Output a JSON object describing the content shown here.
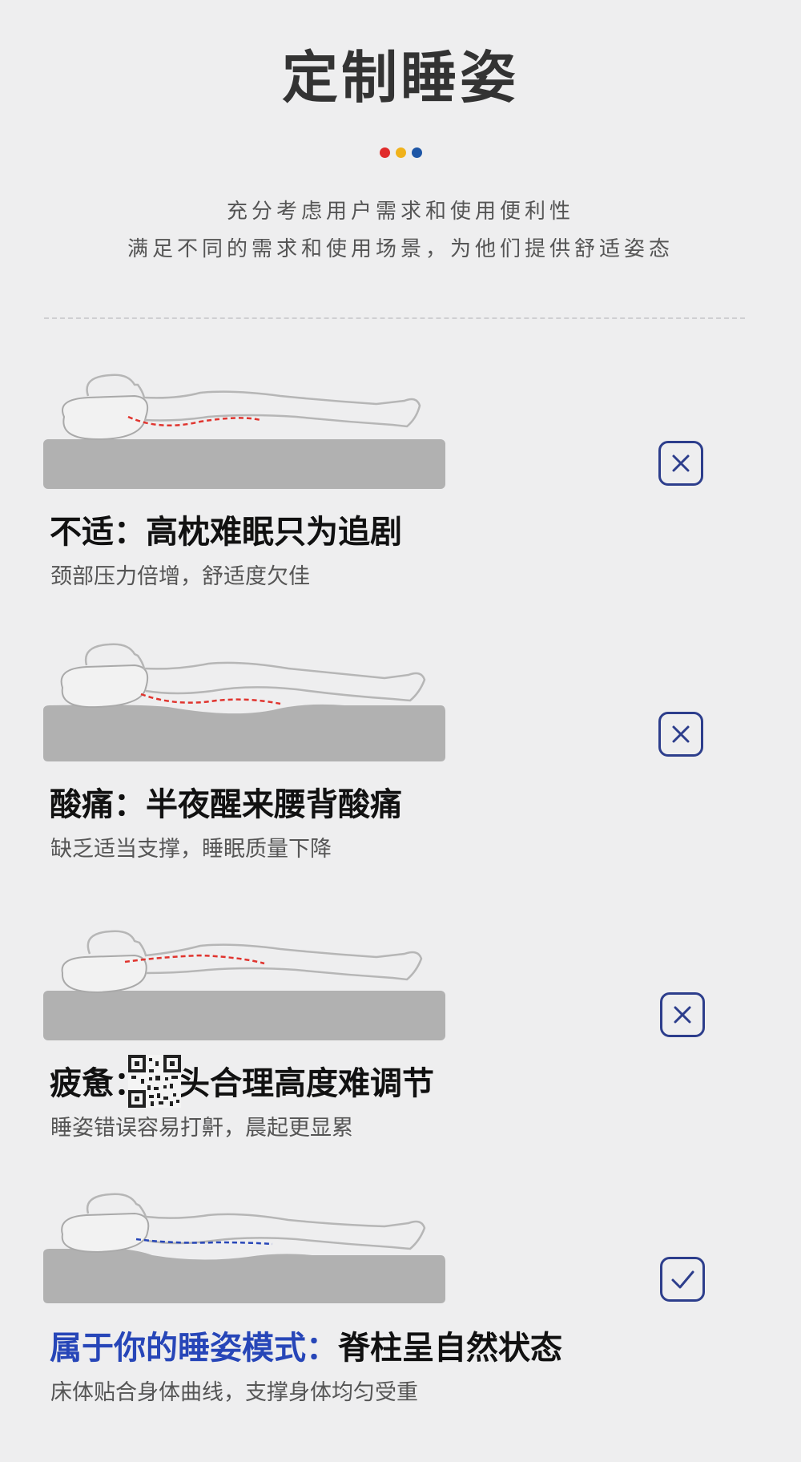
{
  "header": {
    "title": "定制睡姿",
    "subtitle_line1": "充分考虑用户需求和使用便利性",
    "subtitle_line2": "满足不同的需求和使用场景，为他们提供舒适姿态",
    "dot_colors": [
      "#e02b2b",
      "#f0b21b",
      "#1d56a6"
    ]
  },
  "sections": [
    {
      "heading_prefix": "不适：",
      "heading_text": "高枕难眠只为追剧",
      "description": "颈部压力倍增，舒适度欠佳",
      "status": "cross",
      "status_icon": "cross-icon",
      "spine_color": "#e0342e"
    },
    {
      "heading_prefix": "酸痛：",
      "heading_text": "半夜醒来腰背酸痛",
      "description": "缺乏适当支撑，睡眠质量下降",
      "status": "cross",
      "status_icon": "cross-icon",
      "spine_color": "#e0342e"
    },
    {
      "heading_prefix": "疲惫：",
      "heading_text": "枕头合理高度难调节",
      "description": "睡姿错误容易打鼾，晨起更显累",
      "status": "cross",
      "status_icon": "cross-icon",
      "spine_color": "#e0342e"
    },
    {
      "heading_prefix": "属于你的睡姿模式：",
      "heading_text": "脊柱呈自然状态",
      "description": "床体贴合身体曲线，支撑身体均匀受重",
      "status": "check",
      "status_icon": "check-icon",
      "spine_color": "#2746b8"
    }
  ],
  "colors": {
    "accent_blue": "#2746b8",
    "icon_border": "#2d3e8c",
    "mattress": "#b1b1b1"
  }
}
